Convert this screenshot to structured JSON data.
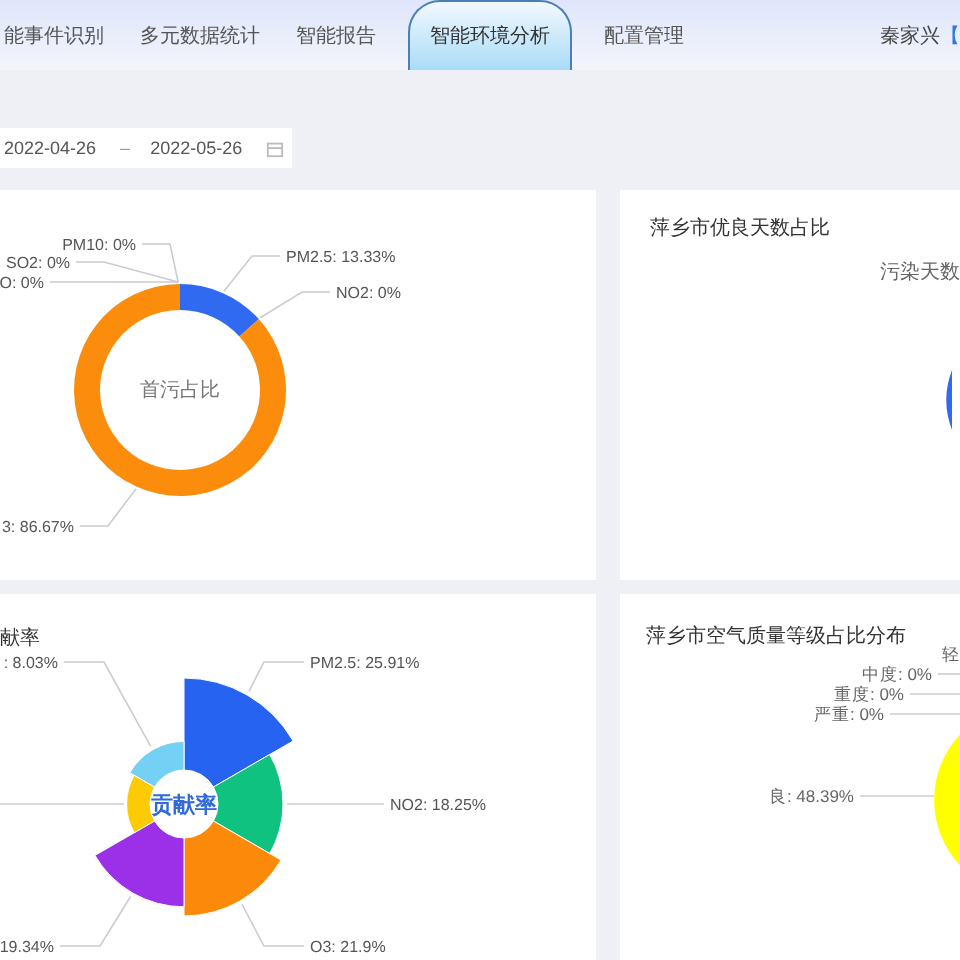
{
  "nav": {
    "tabs": [
      {
        "label": "能事件识别",
        "selected": false
      },
      {
        "label": "多元数据统计",
        "selected": false
      },
      {
        "label": "智能报告",
        "selected": false
      },
      {
        "label": "智能环境分析",
        "selected": true
      },
      {
        "label": "配置管理",
        "selected": false
      }
    ],
    "user_name": "秦家兴",
    "logout_link": "【"
  },
  "date_range": {
    "start": "2022-04-26",
    "separator": "–",
    "end": "2022-05-26"
  },
  "pollutant_share_panel": {
    "kind": "donut",
    "center_label": "首污占比",
    "labels": [
      "PM10: 0%",
      "PM2.5: 13.33%",
      "SO2: 0%",
      "O: 0%",
      "NO2: 0%",
      "3: 86.67%"
    ]
  },
  "good_days_panel": {
    "kind": "legend_pie",
    "title": "萍乡市优良天数占比",
    "legend_items": [
      "污染天数"
    ]
  },
  "contribution_panel": {
    "kind": "rose",
    "title": "献率",
    "center_label": "贡献率",
    "labels": [
      ": 8.03%",
      "PM2.5: 25.91%",
      "NO2: 18.25%",
      "19.34%",
      "O3: 21.9%"
    ]
  },
  "aqi_level_panel": {
    "kind": "label_pie",
    "title": "萍乡市空气质量等级占比分布",
    "labels": [
      "轻",
      "中度: 0%",
      "重度: 0%",
      "严重: 0%",
      "良: 48.39%"
    ]
  }
}
